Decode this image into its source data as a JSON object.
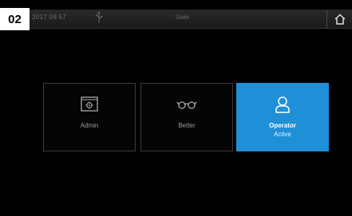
{
  "badge": "02",
  "statusbar": {
    "datetime": "2017  09:57",
    "user": "User",
    "usb_icon": "usb-icon",
    "home_icon": "home-icon"
  },
  "tiles": [
    {
      "label": "Admin",
      "icon": "settings-screen-icon",
      "active": false
    },
    {
      "label": "Better",
      "icon": "glasses-icon",
      "active": false
    },
    {
      "label": "Operator",
      "sublabel": "Active",
      "icon": "user-icon",
      "active": true
    }
  ],
  "colors": {
    "accent": "#1f90d8",
    "background": "#000000",
    "tile_border": "#3c3c3c"
  }
}
